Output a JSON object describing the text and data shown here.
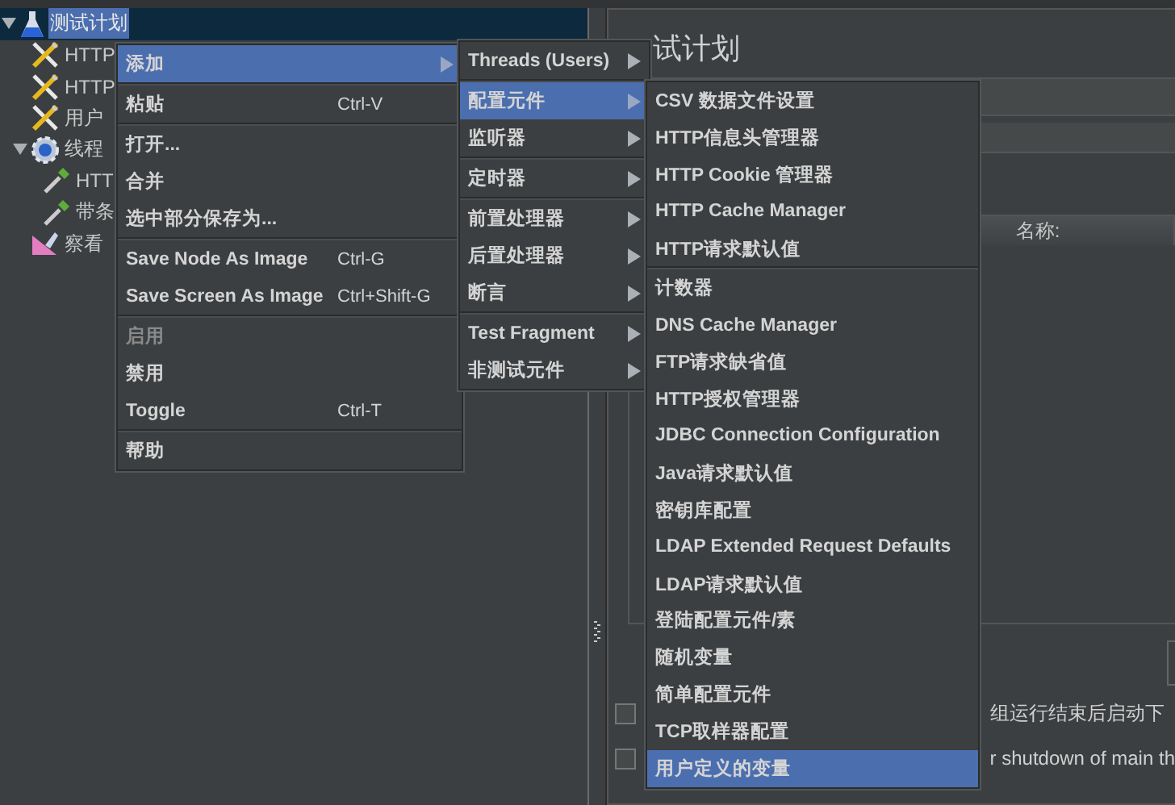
{
  "tree": [
    {
      "label": "测试计划",
      "kind": "plan",
      "selected": true,
      "expanded": true,
      "children": [
        {
          "label": "HTTP",
          "kind": "config",
          "selected": false
        },
        {
          "label": "HTTP",
          "kind": "config",
          "selected": false
        },
        {
          "label": "用户",
          "kind": "config",
          "selected": false
        },
        {
          "label": "线程",
          "kind": "threads",
          "selected": false,
          "expanded": true,
          "children": [
            {
              "label": "HTT",
              "kind": "sampler",
              "selected": false
            },
            {
              "label": "带条",
              "kind": "sampler",
              "selected": false
            }
          ]
        },
        {
          "label": "察看",
          "kind": "listener",
          "selected": false
        }
      ]
    }
  ],
  "panel": {
    "title": "试计划",
    "name_label": "名称:",
    "options": [
      {
        "label": "组运行结束后启动下",
        "checked": false
      },
      {
        "label": "r shutdown of main th",
        "checked": false
      }
    ]
  },
  "menus": [
    {
      "items": [
        {
          "kind": "item",
          "label": "添加",
          "submenu": true,
          "selected": true
        },
        {
          "kind": "separator"
        },
        {
          "kind": "item",
          "label": "粘贴",
          "shortcut": "Ctrl-V",
          "selected": false
        },
        {
          "kind": "separator"
        },
        {
          "kind": "item",
          "label": "打开...",
          "selected": false
        },
        {
          "kind": "item",
          "label": "合并",
          "selected": false
        },
        {
          "kind": "item",
          "label": "选中部分保存为...",
          "selected": false
        },
        {
          "kind": "separator"
        },
        {
          "kind": "item",
          "label": "Save Node As Image",
          "shortcut": "Ctrl-G",
          "selected": false
        },
        {
          "kind": "item",
          "label": "Save Screen As Image",
          "shortcut": "Ctrl+Shift-G",
          "selected": false
        },
        {
          "kind": "separator"
        },
        {
          "kind": "item",
          "label": "启用",
          "disabled": true,
          "selected": false
        },
        {
          "kind": "item",
          "label": "禁用",
          "selected": false
        },
        {
          "kind": "item",
          "label": "Toggle",
          "shortcut": "Ctrl-T",
          "selected": false
        },
        {
          "kind": "separator"
        },
        {
          "kind": "item",
          "label": "帮助",
          "selected": false
        }
      ]
    },
    {
      "items": [
        {
          "kind": "item",
          "label": "Threads (Users)",
          "submenu": true,
          "selected": false
        },
        {
          "kind": "separator"
        },
        {
          "kind": "item",
          "label": "配置元件",
          "submenu": true,
          "selected": true
        },
        {
          "kind": "item",
          "label": "监听器",
          "submenu": true,
          "selected": false
        },
        {
          "kind": "separator"
        },
        {
          "kind": "item",
          "label": "定时器",
          "submenu": true,
          "selected": false
        },
        {
          "kind": "separator"
        },
        {
          "kind": "item",
          "label": "前置处理器",
          "submenu": true,
          "selected": false
        },
        {
          "kind": "item",
          "label": "后置处理器",
          "submenu": true,
          "selected": false
        },
        {
          "kind": "item",
          "label": "断言",
          "submenu": true,
          "selected": false
        },
        {
          "kind": "separator"
        },
        {
          "kind": "item",
          "label": "Test Fragment",
          "submenu": true,
          "selected": false
        },
        {
          "kind": "item",
          "label": "非测试元件",
          "submenu": true,
          "selected": false
        }
      ]
    },
    {
      "items": [
        {
          "kind": "item",
          "label": "CSV 数据文件设置",
          "selected": false
        },
        {
          "kind": "item",
          "label": "HTTP信息头管理器",
          "selected": false
        },
        {
          "kind": "item",
          "label": "HTTP Cookie 管理器",
          "selected": false
        },
        {
          "kind": "item",
          "label": "HTTP Cache Manager",
          "selected": false
        },
        {
          "kind": "item",
          "label": "HTTP请求默认值",
          "selected": false
        },
        {
          "kind": "separator"
        },
        {
          "kind": "item",
          "label": "计数器",
          "selected": false
        },
        {
          "kind": "item",
          "label": "DNS Cache Manager",
          "selected": false
        },
        {
          "kind": "item",
          "label": "FTP请求缺省值",
          "selected": false
        },
        {
          "kind": "item",
          "label": "HTTP授权管理器",
          "selected": false
        },
        {
          "kind": "item",
          "label": "JDBC Connection Configuration",
          "selected": false
        },
        {
          "kind": "item",
          "label": "Java请求默认值",
          "selected": false
        },
        {
          "kind": "item",
          "label": "密钥库配置",
          "selected": false
        },
        {
          "kind": "item",
          "label": "LDAP Extended Request Defaults",
          "selected": false
        },
        {
          "kind": "item",
          "label": "LDAP请求默认值",
          "selected": false
        },
        {
          "kind": "item",
          "label": "登陆配置元件/素",
          "selected": false
        },
        {
          "kind": "item",
          "label": "随机变量",
          "selected": false
        },
        {
          "kind": "item",
          "label": "简单配置元件",
          "selected": false
        },
        {
          "kind": "item",
          "label": "TCP取样器配置",
          "selected": false
        },
        {
          "kind": "item",
          "label": "用户定义的变量",
          "selected": true
        }
      ]
    }
  ]
}
